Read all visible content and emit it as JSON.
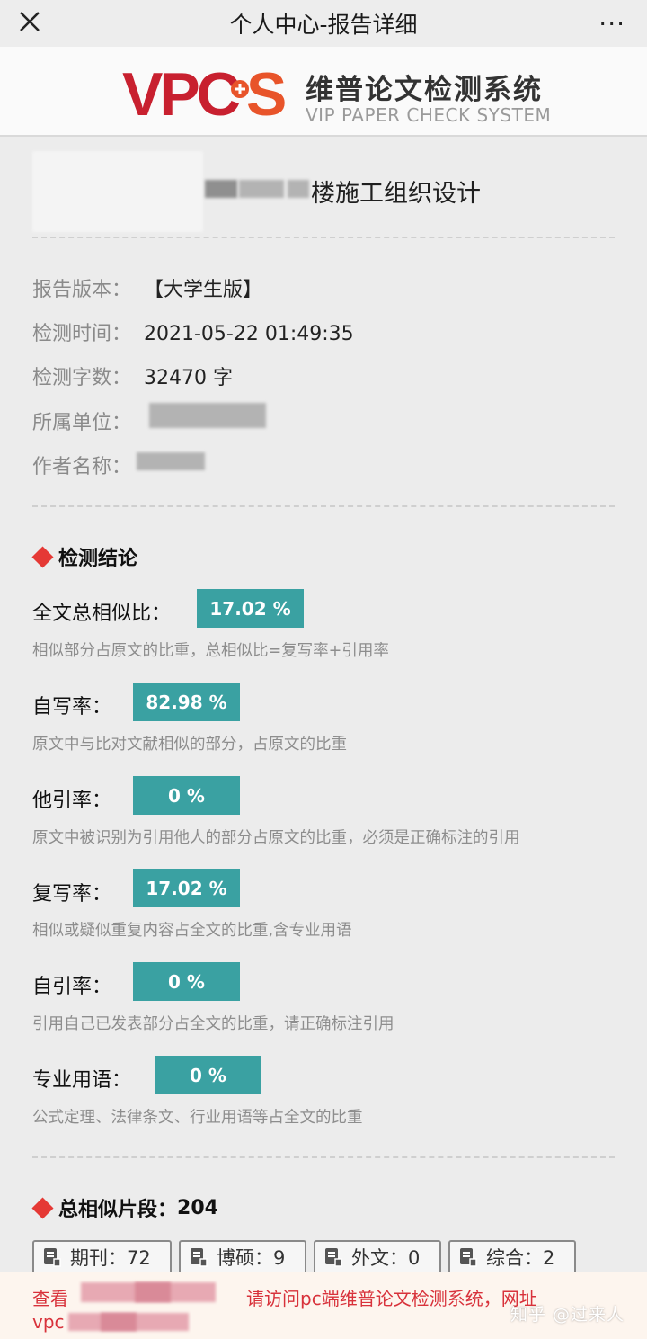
{
  "topbar": {
    "title": "个人中心-报告详细",
    "more_label": "···"
  },
  "logo": {
    "mark": "VPCS",
    "cn_name": "维普论文检测系统",
    "en_name": "VIP PAPER CHECK SYSTEM"
  },
  "paper": {
    "title_visible": "楼施工组织设计"
  },
  "info": [
    {
      "label": "报告版本：",
      "value": "【大学生版】"
    },
    {
      "label": "检测时间：",
      "value": "2021-05-22 01:49:35"
    },
    {
      "label": "检测字数：",
      "value": "32470 字"
    },
    {
      "label": "所属单位：",
      "value": ""
    },
    {
      "label": "作者名称：",
      "value": ""
    }
  ],
  "conclusion": {
    "title": "检测结论",
    "metrics": [
      {
        "label": "全文总相似比：",
        "value": "17.02 %",
        "desc": "相似部分占原文的比重，总相似比=复写率+引用率"
      },
      {
        "label": "自写率：",
        "value": "82.98 %",
        "desc": "原文中与比对文献相似的部分，占原文的比重"
      },
      {
        "label": "他引率：",
        "value": "0 %",
        "desc": "原文中被识别为引用他人的部分占原文的比重，必须是正确标注的引用"
      },
      {
        "label": "复写率：",
        "value": "17.02 %",
        "desc": "相似或疑似重复内容占全文的比重,含专业用语"
      },
      {
        "label": "自引率：",
        "value": "0 %",
        "desc": "引用自己已发表部分占全文的比重，请正确标注引用"
      },
      {
        "label": "专业用语：",
        "value": "0 %",
        "desc": "公式定理、法律条文、行业用语等占全文的比重"
      }
    ]
  },
  "segments": {
    "title": "总相似片段：",
    "total": "204",
    "chips": [
      {
        "label": "期刊：72"
      },
      {
        "label": "博硕：9"
      },
      {
        "label": "外文：0"
      },
      {
        "label": "综合：2"
      }
    ]
  },
  "bottom": {
    "text1": "查看",
    "text2": "请访问pc端维普论文检测系统，网址",
    "text3": "vpc",
    "watermark": "知乎 @过来人"
  },
  "colors": {
    "accent_teal": "#3aa1a2",
    "diamond_red": "#e53935",
    "notice_red": "#d8323b",
    "logo_red": "#c8202f",
    "logo_orange": "#e8542a"
  }
}
